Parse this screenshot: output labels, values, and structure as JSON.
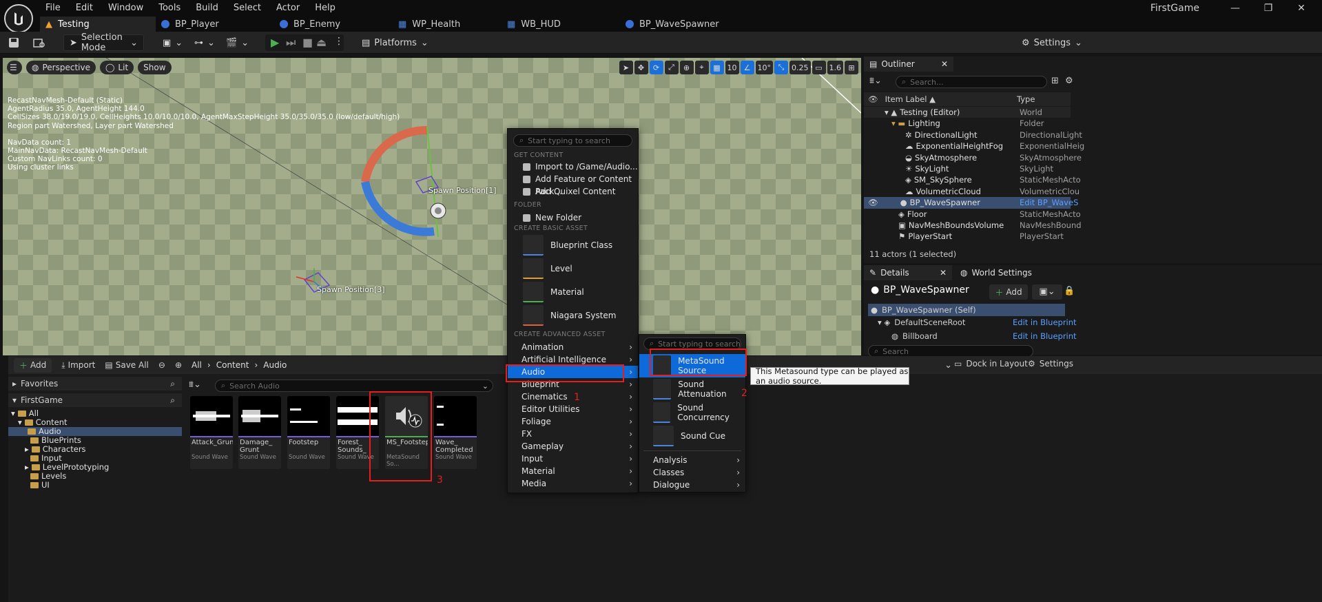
{
  "app": {
    "title": "FirstGame",
    "menu": [
      "File",
      "Edit",
      "Window",
      "Tools",
      "Build",
      "Select",
      "Actor",
      "Help"
    ],
    "window_controls": [
      "—",
      "❐",
      "✕"
    ]
  },
  "tabs": [
    {
      "label": "Testing",
      "icon": "level-icon"
    },
    {
      "label": "BP_Player",
      "icon": "blueprint-icon"
    },
    {
      "label": "BP_Enemy",
      "icon": "blueprint-icon"
    },
    {
      "label": "WP_Health",
      "icon": "widget-icon"
    },
    {
      "label": "WB_HUD",
      "icon": "widget-icon"
    },
    {
      "label": "BP_WaveSpawner",
      "icon": "blueprint-icon"
    }
  ],
  "toolbar": {
    "selection_mode": "Selection Mode",
    "platforms": "Platforms",
    "settings": "Settings"
  },
  "viewport": {
    "perspective": "Perspective",
    "lit": "Lit",
    "show": "Show",
    "grid_value": "10",
    "rotation_value": "10°",
    "scale_value": "0.25",
    "camera_speed": "1.6",
    "nav_debug": [
      "RecastNavMesh-Default (Static)",
      "AgentRadius 35.0, AgentHeight 144.0",
      "CellSizes 38.0/19.0/19.0, CellHeights 10.0/10.0/10.0, AgentMaxStepHeight 35.0/35.0/35.0 (low/default/high)",
      "Region part Watershed, Layer part Watershed",
      "",
      "NavData count: 1",
      "MainNavData: RecastNavMesh-Default",
      "Custom NavLinks count: 0",
      "Using cluster links"
    ],
    "spawn1": "Spawn Position[1]",
    "spawn3": "Spawn Position[3]"
  },
  "outliner": {
    "tab": "Outliner",
    "search_placeholder": "Search...",
    "col_label": "Item Label ▲",
    "col_type": "Type",
    "rows": [
      {
        "label": "Testing (Editor)",
        "type": "World"
      },
      {
        "label": "Lighting",
        "type": "Folder"
      },
      {
        "label": "DirectionalLight",
        "type": "DirectionalLight"
      },
      {
        "label": "ExponentialHeightFog",
        "type": "ExponentialHeig"
      },
      {
        "label": "SkyAtmosphere",
        "type": "SkyAtmosphere"
      },
      {
        "label": "SkyLight",
        "type": "SkyLight"
      },
      {
        "label": "SM_SkySphere",
        "type": "StaticMeshActo"
      },
      {
        "label": "VolumetricCloud",
        "type": "VolumetricClou"
      },
      {
        "label": "BP_WaveSpawner",
        "type": "Edit BP_WaveS"
      },
      {
        "label": "Floor",
        "type": "StaticMeshActo"
      },
      {
        "label": "NavMeshBoundsVolume",
        "type": "NavMeshBound"
      },
      {
        "label": "PlayerStart",
        "type": "PlayerStart"
      }
    ],
    "status": "11 actors (1 selected)"
  },
  "details": {
    "tab": "Details",
    "tab2": "World Settings",
    "actor": "BP_WaveSpawner",
    "add": "Add",
    "self": "BP_WaveSpawner (Self)",
    "root": "DefaultSceneRoot",
    "billboard": "Billboard",
    "edit_bp": "Edit in Blueprint",
    "search": "Search"
  },
  "content_browser": {
    "add": "Add",
    "import": "Import",
    "save_all": "Save All",
    "path": [
      "All",
      "Content",
      "Audio"
    ],
    "dock": "Dock in Layout",
    "settings": "Settings",
    "favorites": "Favorites",
    "project": "FirstGame",
    "search_placeholder": "Search Audio",
    "folders": [
      "All",
      "Content",
      "Audio",
      "BluePrints",
      "Characters",
      "Input",
      "LevelPrototyping",
      "Levels",
      "UI"
    ],
    "assets": [
      {
        "name": "Attack_Grunt",
        "kind": "Sound Wave"
      },
      {
        "name": "Damage_ Grunt",
        "kind": "Sound Wave"
      },
      {
        "name": "Footstep",
        "kind": "Sound Wave"
      },
      {
        "name": "Forest_ Sounds_",
        "kind": "Sound Wave"
      },
      {
        "name": "MS_Footstep",
        "kind": "MetaSound So..."
      },
      {
        "name": "Wave_ Completed",
        "kind": "Sound Wave"
      }
    ]
  },
  "context_menu": {
    "search_placeholder": "Start typing to search",
    "get_content": "GET CONTENT",
    "import": "Import to /Game/Audio...",
    "add_feature": "Add Feature or Content Pack...",
    "add_quixel": "Add Quixel Content",
    "folder_head": "FOLDER",
    "new_folder": "New Folder",
    "basic_head": "CREATE BASIC ASSET",
    "basic": [
      "Blueprint Class",
      "Level",
      "Material",
      "Niagara System"
    ],
    "advanced_head": "CREATE ADVANCED ASSET",
    "advanced": [
      "Animation",
      "Artificial Intelligence",
      "Audio",
      "Blueprint",
      "Cinematics",
      "Editor Utilities",
      "Foliage",
      "FX",
      "Gameplay",
      "Input",
      "Material",
      "Media"
    ]
  },
  "sub_menu": {
    "search_placeholder": "Start typing to search",
    "items": [
      "MetaSound Source",
      "Sound Attenuation",
      "Sound Concurrency",
      "Sound Cue"
    ],
    "more": [
      "Analysis",
      "Classes",
      "Dialogue"
    ]
  },
  "tooltip": "This Metasound type can be played as an audio source.",
  "annotations": [
    "1",
    "2",
    "3"
  ]
}
